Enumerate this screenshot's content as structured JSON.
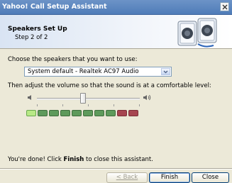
{
  "window": {
    "title": "Yahoo! Call Setup Assistant"
  },
  "header": {
    "title": "Speakers Set Up",
    "step": "Step 2 of 2"
  },
  "speaker_select": {
    "label": "Choose the speakers that you want to use:",
    "selected": "System default - Realtek AC97 Audio"
  },
  "volume": {
    "label": "Then adjust the volume so that the sound is at a comfortable level:",
    "level_fraction": 0.45,
    "meter_colors": [
      "#5e9a5b",
      "#5e9a5b",
      "#5e9a5b",
      "#5e9a5b",
      "#5e9a5b",
      "#5e9a5b",
      "#5e9a5b",
      "#5e9a5b",
      "#a64550",
      "#a64550"
    ],
    "active_color": "#b8e986"
  },
  "footer": {
    "done_prefix": "You're done! Click ",
    "done_bold": "Finish",
    "done_suffix": " to close this assistant.",
    "back_label": "< Back",
    "finish_label": "Finish",
    "close_label": "Close"
  }
}
